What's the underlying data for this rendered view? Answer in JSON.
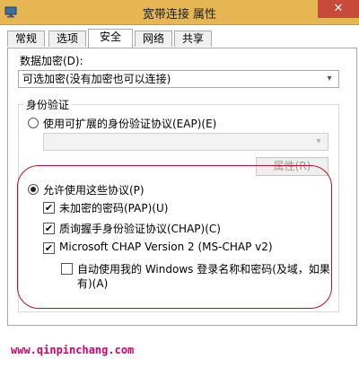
{
  "window": {
    "title": "宽带连接 属性",
    "close_glyph": "✕"
  },
  "tabs": [
    {
      "label": "常规",
      "active": false
    },
    {
      "label": "选项",
      "active": false
    },
    {
      "label": "安全",
      "active": true
    },
    {
      "label": "网络",
      "active": false
    },
    {
      "label": "共享",
      "active": false
    }
  ],
  "security": {
    "encryption_label": "数据加密(D):",
    "encryption_value": "可选加密(没有加密也可以连接)",
    "auth_group_title": "身份验证",
    "eap_option_label": "使用可扩展的身份验证协议(EAP)(E)",
    "eap_option_selected": false,
    "eap_select_value": "",
    "properties_button": "属性(R)",
    "allow_protocols_label": "允许使用这些协议(P)",
    "allow_protocols_selected": true,
    "protocols": [
      {
        "label": "未加密的密码(PAP)(U)",
        "checked": true
      },
      {
        "label": "质询握手身份验证协议(CHAP)(C)",
        "checked": true
      },
      {
        "label": "Microsoft CHAP Version 2 (MS-CHAP v2)",
        "checked": true
      }
    ],
    "auto_windows_logon_line1": "自动使用我的 Windows 登录名称和密码(及域，如果",
    "auto_windows_logon_line2": "有)(A)",
    "auto_windows_logon_checked": false
  },
  "watermark": "www.qinpinchang.com",
  "colors": {
    "titlebar": "#e6b653",
    "close_button": "#c74a3b",
    "highlight_oval": "#b8102a",
    "watermark": "#d1006e"
  },
  "icons": {
    "caret": "▾",
    "check": "✔"
  }
}
